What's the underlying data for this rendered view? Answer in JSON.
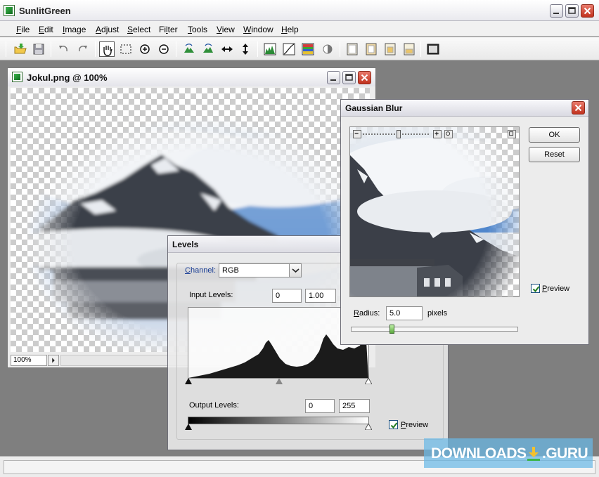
{
  "app": {
    "title": "SunlitGreen"
  },
  "menu": [
    {
      "pre": "",
      "u": "F",
      "post": "ile"
    },
    {
      "pre": "",
      "u": "E",
      "post": "dit"
    },
    {
      "pre": "",
      "u": "I",
      "post": "mage"
    },
    {
      "pre": "",
      "u": "A",
      "post": "djust"
    },
    {
      "pre": "",
      "u": "S",
      "post": "elect"
    },
    {
      "pre": "Fi",
      "u": "l",
      "post": "ter"
    },
    {
      "pre": "",
      "u": "T",
      "post": "ools"
    },
    {
      "pre": "",
      "u": "V",
      "post": "iew"
    },
    {
      "pre": "",
      "u": "W",
      "post": "indow"
    },
    {
      "pre": "",
      "u": "H",
      "post": "elp"
    }
  ],
  "toolbar_icons": [
    "open-folder-icon",
    "save-icon",
    "undo-icon",
    "redo-icon",
    "hand-tool-icon",
    "marquee-select-icon",
    "zoom-in-icon",
    "zoom-out-icon",
    "rotate-left-icon",
    "rotate-right-icon",
    "flip-horizontal-icon",
    "flip-vertical-icon",
    "histogram-icon",
    "curves-icon",
    "hue-saturation-icon",
    "brightness-contrast-icon",
    "frame-1-icon",
    "frame-2-icon",
    "frame-3-icon",
    "frame-4-icon",
    "fullscreen-icon"
  ],
  "image_window": {
    "title": "Jokul.png @ 100%",
    "zoom": "100%"
  },
  "levels": {
    "title": "Levels",
    "channel_label_u": "C",
    "channel_label_rest": "hannel:",
    "channel_value": "RGB",
    "input_label": "Input Levels:",
    "input_black": "0",
    "input_gamma": "1.00",
    "output_label": "Output Levels:",
    "output_black": "0",
    "output_white": "255",
    "preview_u": "P",
    "preview_rest": "review",
    "preview_checked": true
  },
  "gaussian": {
    "title": "Gaussian Blur",
    "ok": "OK",
    "reset": "Reset",
    "radius_label_u": "R",
    "radius_label_rest": "adius:",
    "radius_value": "5.0",
    "radius_unit": "pixels",
    "radius_slider_fraction": 0.24,
    "preview_u": "P",
    "preview_rest": "review",
    "preview_checked": true
  },
  "watermark": {
    "left": "DOWNLOADS",
    "right": ".GURU"
  },
  "colors": {
    "accent_green": "#39b54a",
    "close_red": "#c1321e",
    "sky_blue": "#5a8fd0"
  }
}
